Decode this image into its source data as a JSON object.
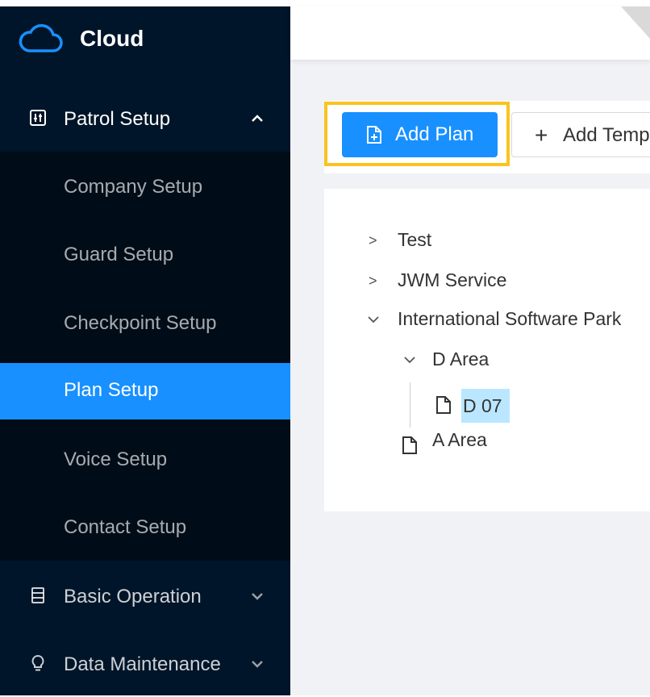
{
  "app": {
    "title": "Cloud"
  },
  "sidebar": {
    "patrol_setup": {
      "label": "Patrol Setup"
    },
    "subitems": [
      {
        "label": "Company Setup"
      },
      {
        "label": "Guard Setup"
      },
      {
        "label": "Checkpoint Setup"
      },
      {
        "label": "Plan Setup",
        "active": true
      },
      {
        "label": "Voice Setup"
      },
      {
        "label": "Contact Setup"
      }
    ],
    "basic_operation": {
      "label": "Basic Operation"
    },
    "data_maintenance": {
      "label": "Data Maintenance"
    }
  },
  "toolbar": {
    "add_plan_label": "Add Plan",
    "add_template_label": "Add Temp"
  },
  "tree": {
    "nodes": [
      {
        "label": "Test",
        "expanded": false
      },
      {
        "label": "JWM Service",
        "expanded": false
      },
      {
        "label": "International Software Park",
        "expanded": true
      },
      {
        "label": "D Area",
        "expanded": true
      },
      {
        "label": "D 07",
        "selected": true
      },
      {
        "label": "A Area"
      }
    ]
  },
  "colors": {
    "sidebar_bg": "#001529",
    "submenu_bg": "#000c17",
    "accent": "#1890ff",
    "highlight": "#fac31f",
    "selected_node": "#bae7ff"
  }
}
